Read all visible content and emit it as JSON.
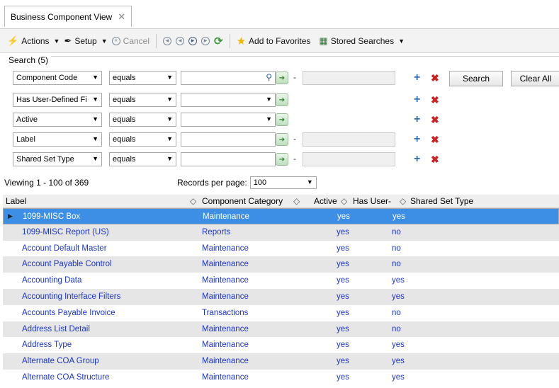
{
  "window": {
    "tab_title": "Business Component View",
    "tab_close": "✕"
  },
  "toolbar": {
    "actions_label": "Actions",
    "setup_label": "Setup",
    "cancel_label": "Cancel",
    "add_favorites_label": "Add to Favorites",
    "stored_searches_label": "Stored Searches"
  },
  "search": {
    "legend": "Search (5)",
    "search_button": "Search",
    "clear_button": "Clear All",
    "dash": "-",
    "rows": [
      {
        "field": "Component Code",
        "operator": "equals"
      },
      {
        "field": "Has User-Defined Fi",
        "operator": "equals"
      },
      {
        "field": "Active",
        "operator": "equals"
      },
      {
        "field": "Label",
        "operator": "equals"
      },
      {
        "field": "Shared Set Type",
        "operator": "equals"
      }
    ]
  },
  "paging": {
    "viewing": "Viewing 1 - 100 of 369",
    "records_per_page_label": "Records per page:",
    "records_per_page_value": "100"
  },
  "grid": {
    "columns": {
      "label": "Label",
      "category": "Component Category",
      "active": "Active",
      "has_user": "Has User-",
      "shared": "Shared Set Type"
    },
    "sort_icon": "◇",
    "rows": [
      {
        "label": "1099-MISC Box",
        "category": "Maintenance",
        "active": "yes",
        "has_user": "yes"
      },
      {
        "label": "1099-MISC Report (US)",
        "category": "Reports",
        "active": "yes",
        "has_user": "no"
      },
      {
        "label": "Account Default Master",
        "category": "Maintenance",
        "active": "yes",
        "has_user": "no"
      },
      {
        "label": "Account Payable Control",
        "category": "Maintenance",
        "active": "yes",
        "has_user": "no"
      },
      {
        "label": "Accounting Data",
        "category": "Maintenance",
        "active": "yes",
        "has_user": "yes"
      },
      {
        "label": "Accounting Interface Filters",
        "category": "Maintenance",
        "active": "yes",
        "has_user": "yes"
      },
      {
        "label": "Accounts Payable Invoice",
        "category": "Transactions",
        "active": "yes",
        "has_user": "no"
      },
      {
        "label": "Address List Detail",
        "category": "Maintenance",
        "active": "yes",
        "has_user": "no"
      },
      {
        "label": "Address Type",
        "category": "Maintenance",
        "active": "yes",
        "has_user": "yes"
      },
      {
        "label": "Alternate COA Group",
        "category": "Maintenance",
        "active": "yes",
        "has_user": "yes"
      },
      {
        "label": "Alternate COA Structure",
        "category": "Maintenance",
        "active": "yes",
        "has_user": "yes"
      }
    ]
  },
  "colors": {
    "selected_row": "#3d8ee5",
    "link_text": "#1b35c9",
    "alt_row": "#e6e6e6"
  }
}
